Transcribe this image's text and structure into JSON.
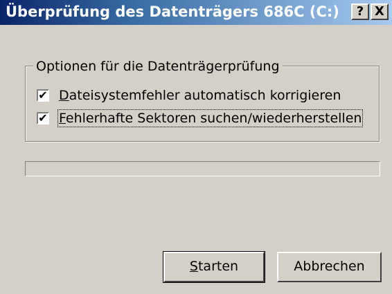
{
  "window": {
    "title": "Überprüfung des Datenträgers 686C (C:)",
    "help_button": "?",
    "close_button": "X"
  },
  "options_group": {
    "legend": "Optionen für die Datenträgerprüfung",
    "checkboxes": [
      {
        "accel": "D",
        "label_rest": "ateisystemfehler automatisch korrigieren",
        "checked": true,
        "check_glyph": "✔"
      },
      {
        "accel": "F",
        "label_rest": "ehlerhafte Sektoren suchen/wiederherstellen",
        "checked": true,
        "check_glyph": "✔"
      }
    ]
  },
  "progress": {
    "value": 0
  },
  "buttons": {
    "start": {
      "accel": "S",
      "label_rest": "tarten"
    },
    "cancel": {
      "label": "Abbrechen"
    }
  }
}
